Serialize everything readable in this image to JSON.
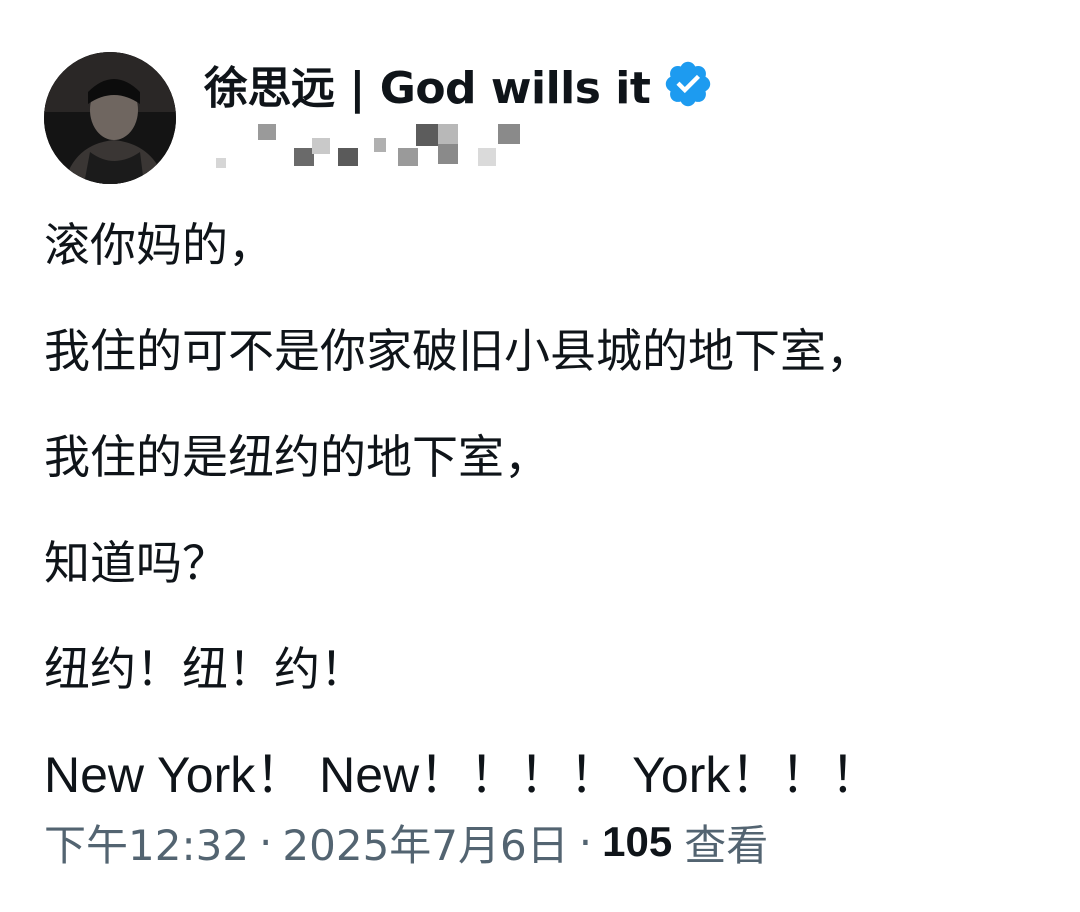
{
  "author": {
    "display_name": "徐思远 | God wills it",
    "verified_icon": "verified-badge-icon",
    "verified_color": "#1d9bf0",
    "handle_obscured": true
  },
  "tweet": {
    "lines": [
      "滚你妈的，",
      "我住的可不是你家破旧小县城的地下室，",
      "我住的是纽约的地下室，",
      "知道吗？",
      "纽约！纽！约！",
      "New York！ New！！！！ York！！！"
    ]
  },
  "meta": {
    "time": "下午12:32",
    "separator": "·",
    "date": "2025年7月6日",
    "views_count": "105",
    "views_label": "查看"
  },
  "colors": {
    "text": "#0f1419",
    "secondary": "#536471",
    "background": "#ffffff"
  }
}
